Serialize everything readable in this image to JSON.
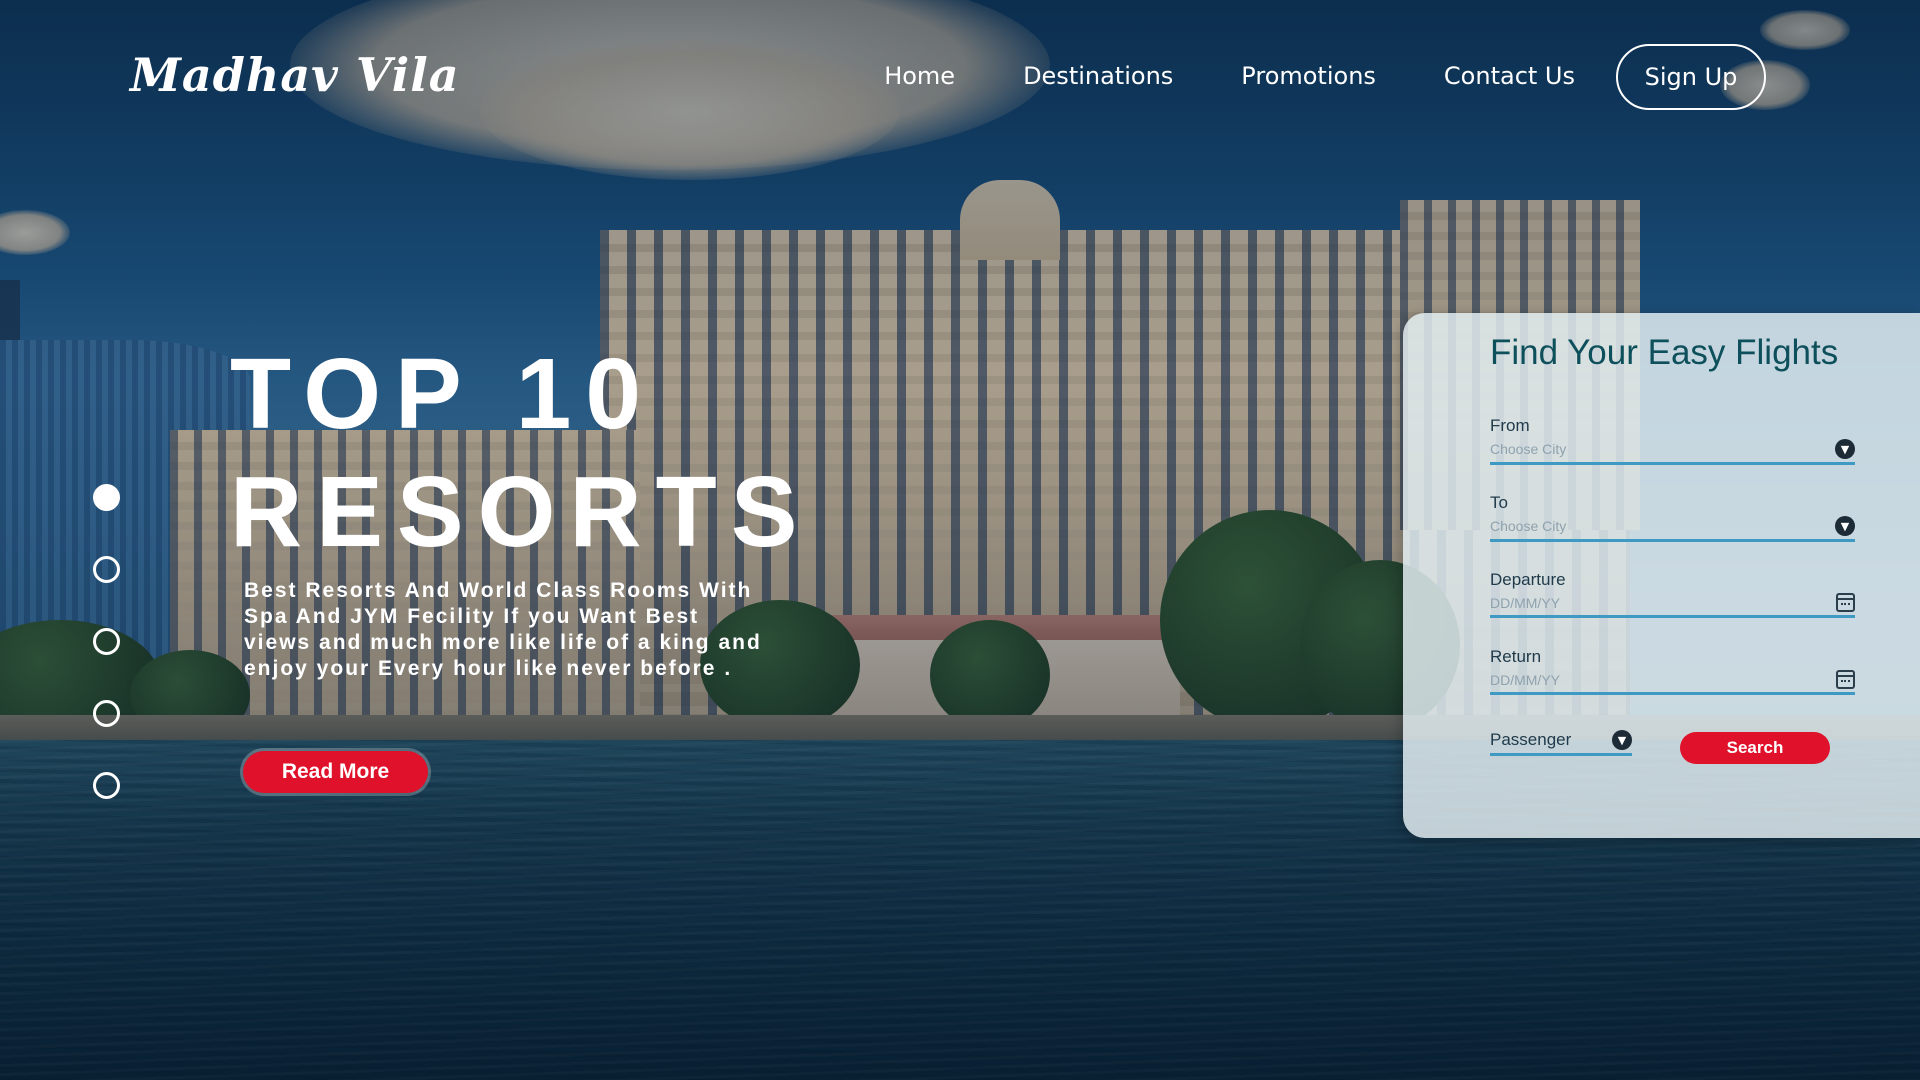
{
  "brand": {
    "name": "Madhav Vila"
  },
  "nav": {
    "items": [
      {
        "label": "Home"
      },
      {
        "label": "Destinations"
      },
      {
        "label": "Promotions"
      },
      {
        "label": "Contact Us"
      }
    ],
    "signup_label": "Sign Up"
  },
  "hero": {
    "title_line1": "TOP 10",
    "title_line2": "RESORTS",
    "description": "Best Resorts And World Class Rooms With Spa And JYM Fecility If you Want Best views and much more like life of a king and enjoy your Every hour like never before .",
    "cta_label": "Read More",
    "slider": {
      "count": 5,
      "active_index": 0
    }
  },
  "search": {
    "title": "Find Your Easy Flights",
    "from": {
      "label": "From",
      "placeholder": "Choose City"
    },
    "to": {
      "label": "To",
      "placeholder": "Choose City"
    },
    "departure": {
      "label": "Departure",
      "placeholder": "DD/MM/YY"
    },
    "return": {
      "label": "Return",
      "placeholder": "DD/MM/YY"
    },
    "passenger": {
      "label": "Passenger"
    },
    "button_label": "Search"
  },
  "colors": {
    "accent": "#e0112b",
    "field_underline": "#3e9ac2",
    "title_teal": "#0d4f5a"
  },
  "icons": {
    "dropdown": "chevron-down-icon",
    "calendar": "calendar-icon"
  }
}
